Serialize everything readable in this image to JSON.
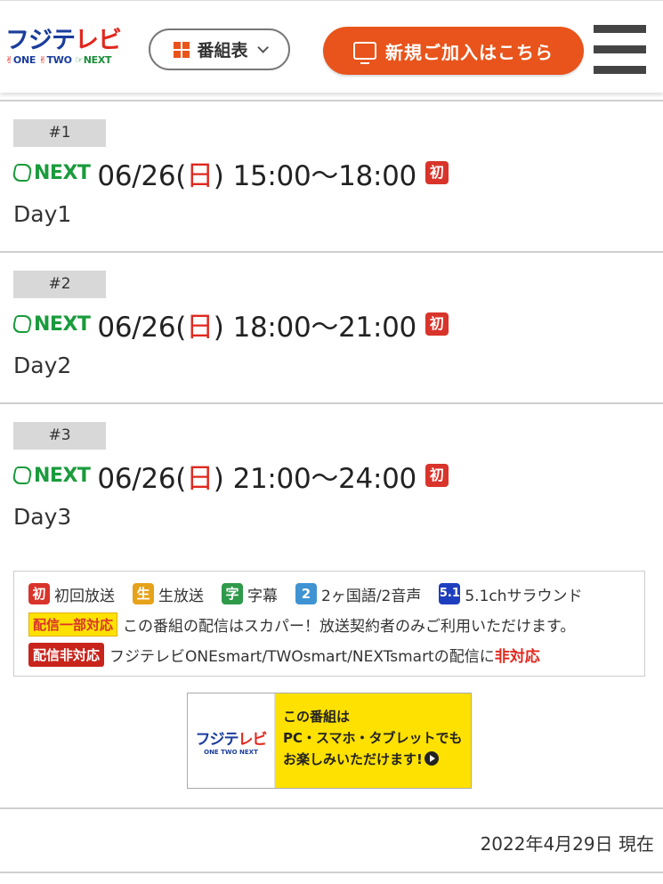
{
  "header": {
    "logo": {
      "text_a": "フジテ",
      "text_b": "レビ",
      "sub_one": "ONE",
      "sub_two": "TWO",
      "sub_next": "NEXT"
    },
    "schedule_button": {
      "label": "番組表",
      "icon": "grid-icon"
    },
    "join_button": {
      "label": "新規ご加入はこちら",
      "icon": "tv-icon"
    },
    "menu_icon": "hamburger-icon"
  },
  "episodes": [
    {
      "badge": "#1",
      "channel": "NEXT",
      "date_prefix": "06/26(",
      "weekday": "日",
      "date_suffix": ")",
      "time": "15:00〜18:00",
      "flag": "初",
      "title": "Day1"
    },
    {
      "badge": "#2",
      "channel": "NEXT",
      "date_prefix": "06/26(",
      "weekday": "日",
      "date_suffix": ")",
      "time": "18:00〜21:00",
      "flag": "初",
      "title": "Day2"
    },
    {
      "badge": "#3",
      "channel": "NEXT",
      "date_prefix": "06/26(",
      "weekday": "日",
      "date_suffix": ")",
      "time": "21:00〜24:00",
      "flag": "初",
      "title": "Day3"
    }
  ],
  "legend": {
    "items": [
      {
        "mark": "初",
        "text": "初回放送",
        "color": "#d9342b"
      },
      {
        "mark": "生",
        "text": "生放送",
        "color": "#e5a21a"
      },
      {
        "mark": "字",
        "text": "字幕",
        "color": "#2f9a4b"
      },
      {
        "mark": "2",
        "text": "2ヶ国語/2音声",
        "color": "#3f93d2"
      },
      {
        "mark": "5.1",
        "text": "5.1chサラウンド",
        "color": "#1d3fbf"
      }
    ],
    "partial_tag": "配信一部対応",
    "partial_text": "この番組の配信はスカパー！放送契約者のみご利用いただけます。",
    "none_tag": "配信非対応",
    "none_text": "フジテレビONEsmart/TWOsmart/NEXTsmartの配信に",
    "none_emph": "非対応"
  },
  "banner": {
    "logo_a": "フジテ",
    "logo_b": "レビ",
    "logo_sub": "ONE TWO NEXT",
    "line1": "この番組は",
    "line2": "PC・スマホ・タブレットでも",
    "line3": "お楽しみいただけます!"
  },
  "as_of": "2022年4月29日 現在"
}
